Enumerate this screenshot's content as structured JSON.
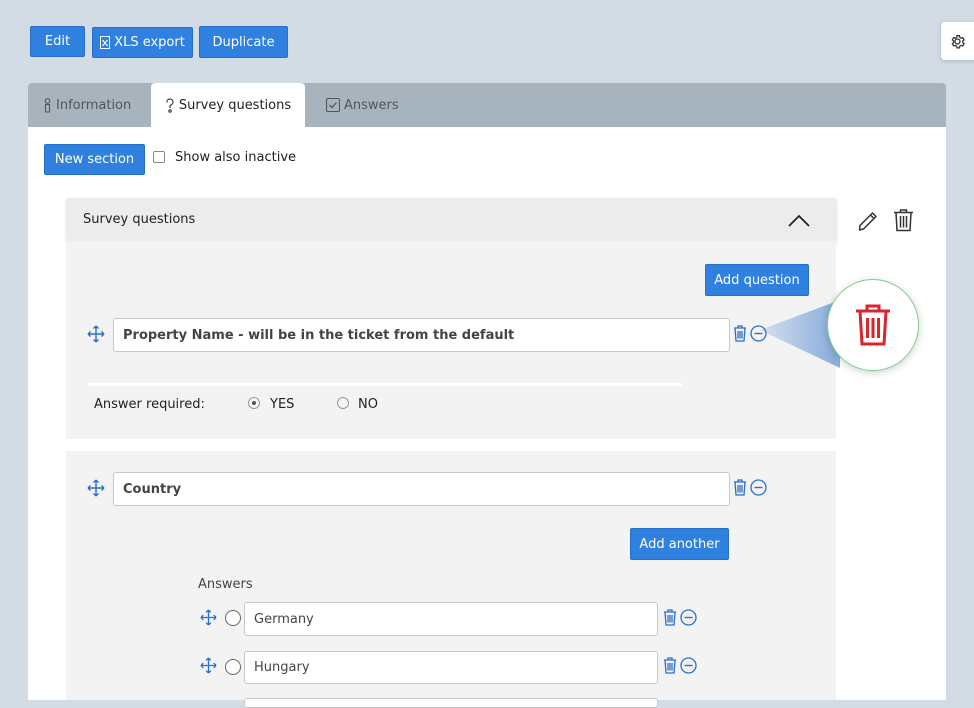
{
  "toolbar": {
    "edit_label": "Edit",
    "xls_label": "XLS export",
    "duplicate_label": "Duplicate"
  },
  "tabs": [
    {
      "label": "Information",
      "icon": "person-icon"
    },
    {
      "label": "Survey questions",
      "icon": "question-icon"
    },
    {
      "label": "Answers",
      "icon": "checkbox-icon"
    }
  ],
  "controls": {
    "new_section_label": "New section",
    "show_inactive_label": "Show also inactive"
  },
  "section": {
    "title": "Survey questions",
    "add_question_label": "Add question"
  },
  "question1": {
    "text": "Property Name - will be in the ticket from the default",
    "answer_required_label": "Answer required:",
    "yes_label": "YES",
    "no_label": "NO",
    "selected": "YES"
  },
  "question2": {
    "text": "Country",
    "add_another_label": "Add another",
    "answers_label": "Answers",
    "answers": [
      "Germany",
      "Hungary"
    ]
  },
  "colors": {
    "accent": "#2f80df",
    "icon_blue": "#2a6fc9",
    "delete_red": "#d9262b",
    "highlight_green": "#7ccf86"
  }
}
